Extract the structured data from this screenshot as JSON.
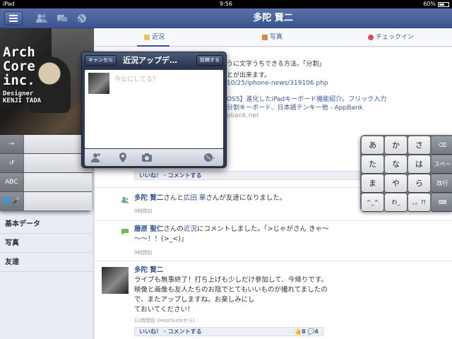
{
  "status_bar": {
    "device": "iPad",
    "time": "9:56",
    "battery": "60%",
    "battery_level": 0.6
  },
  "navbar": {
    "title": "多陀 賢二",
    "menu_icon": "hamburger-icon",
    "icons": [
      "friends-icon",
      "messages-icon",
      "globe-icon"
    ]
  },
  "sidebar": {
    "cover_text": {
      "line1": "Arch",
      "line2": "Core",
      "line3": "inc.",
      "designer": "Designer",
      "name": "KENJI TADA"
    },
    "items": [
      {
        "label": "基本データ"
      },
      {
        "label": "写真"
      },
      {
        "label": "友達"
      }
    ]
  },
  "tabs": [
    {
      "label": "近況",
      "icon": "status-icon",
      "active": true
    },
    {
      "label": "写真",
      "icon": "photo-icon",
      "active": false
    },
    {
      "label": "チェックイン",
      "icon": "checkin-icon",
      "active": false
    }
  ],
  "feed": {
    "fragments": {
      "line1": "うに文字うちできる方法。「分割」",
      "line2": "とが出来ます。",
      "link1": "10/25/iphone-news/319106.php",
      "link2": "OS5】進化したiPadキーボード機能紹介。フリック入力",
      "link3": "分割キーボード、日本語テンキー他 - AppBank",
      "domain": "pbank.net"
    },
    "actions1": "いいね！ · コメントする",
    "story_friends": {
      "actor": "多陀 賢二",
      "text_mid": "さんと",
      "other": "広田 華",
      "text_end": "さんが友達になりました。",
      "time": "9時間前"
    },
    "story_comment": {
      "actor": "藤原 聖仁",
      "text_mid": "さんの",
      "link": "近況",
      "text_end": "にコメントしました。「>じゃがさん きゃ〜",
      "line2": "〜〜！！(>_<)」",
      "time": "9時間前"
    },
    "story_post": {
      "actor": "多陀 賢二",
      "line1": "ライブも無事終了！打ち上げも少しだけ参加して、今帰りです。",
      "line2": "映像と画像も友人たちのお陰でとてもいいものが撮れてましたの",
      "line3": "で、またアップしますね。お楽しみにし",
      "line4": "ておいてください！",
      "time": "11時間前 (HootSuiteから) · ",
      "actions": "いいね！ · コメントする",
      "likes": "8",
      "comments": "4"
    }
  },
  "compose": {
    "cancel": "キャンセル",
    "title": "近況アップデ…",
    "post": "投稿する",
    "placeholder": "今なにしてる？",
    "toolbar_icons": [
      "tag-friends-icon",
      "location-pin-icon",
      "camera-icon",
      "audience-globe-icon"
    ]
  },
  "keyboard_left": {
    "keys": [
      {
        "label": "→"
      },
      {
        "label": "↺"
      },
      {
        "label": "ABC"
      },
      {
        "label": "🌐 🎤"
      }
    ]
  },
  "keyboard_right": {
    "rows": [
      [
        "あ",
        "か",
        "さ",
        "⌫"
      ],
      [
        "た",
        "な",
        "は",
        "スペース"
      ],
      [
        "ま",
        "や",
        "ら",
        "改行"
      ],
      [
        "^_^",
        "わ_",
        "、。?!",
        "⌨"
      ]
    ]
  }
}
